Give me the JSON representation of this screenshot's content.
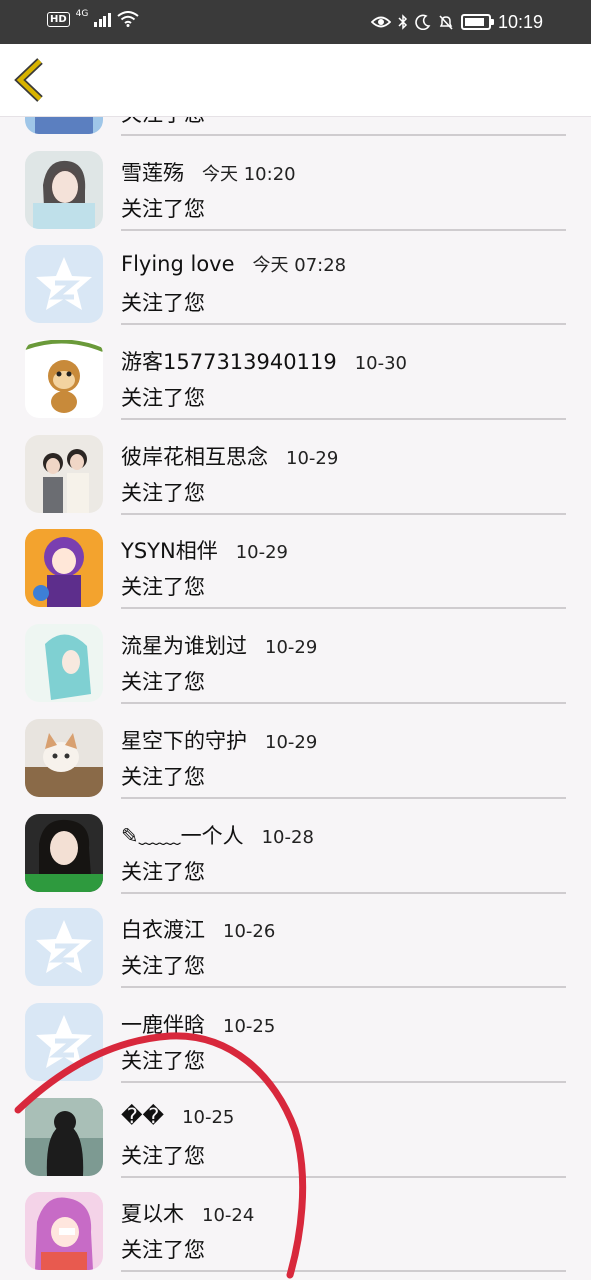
{
  "status_bar": {
    "hd": "HD",
    "network": "4G",
    "time": "10:19",
    "battery_level": 0.85
  },
  "header": {
    "back_icon": "chevron-left-icon",
    "accent_color": "#d8b300"
  },
  "rows": [
    {
      "name": "",
      "time": "",
      "message": "关注了您",
      "avatar": "photo-blue"
    },
    {
      "name": "雪莲殇",
      "time": "今天 10:20",
      "message": "关注了您",
      "avatar": "photo-girl-light"
    },
    {
      "name": "Flying love",
      "time": "今天 07:28",
      "message": "关注了您",
      "avatar": "default-star"
    },
    {
      "name": "游客1577313940119",
      "time": "10-30",
      "message": "关注了您",
      "avatar": "monkey"
    },
    {
      "name": "彼岸花相互思念",
      "time": "10-29",
      "message": "关注了您",
      "avatar": "photo-couple"
    },
    {
      "name": "YSYN相伴",
      "time": "10-29",
      "message": "关注了您",
      "avatar": "anime-purple"
    },
    {
      "name": "流星为谁划过",
      "time": "10-29",
      "message": "关注了您",
      "avatar": "anime-cyan"
    },
    {
      "name": "星空下的守护",
      "time": "10-29",
      "message": "关注了您",
      "avatar": "kitten"
    },
    {
      "name": "✎﹏﹏一个人",
      "time": "10-28",
      "message": "关注了您",
      "avatar": "photo-girl-green"
    },
    {
      "name": "白衣渡江",
      "time": "10-26",
      "message": "关注了您",
      "avatar": "default-star"
    },
    {
      "name": "一鹿伴晗",
      "time": "10-25",
      "message": "关注了您",
      "avatar": "default-star"
    },
    {
      "name": "��",
      "time": "10-25",
      "message": "关注了您",
      "avatar": "photo-dark"
    },
    {
      "name": "夏以木",
      "time": "10-24",
      "message": "关注了您",
      "avatar": "anime-pink"
    }
  ],
  "annotation_color": "#d8283c"
}
